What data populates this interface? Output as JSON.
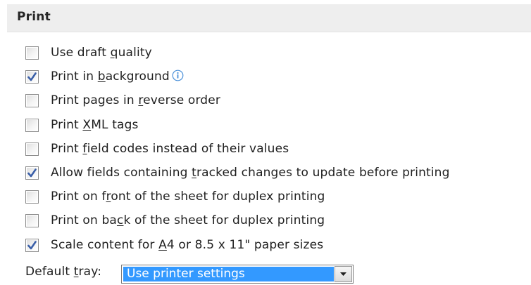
{
  "section": {
    "title": "Print"
  },
  "options": [
    {
      "id": "draft",
      "pre": "Use draft ",
      "u": "q",
      "post": "uality",
      "checked": false
    },
    {
      "id": "background",
      "pre": "Print in ",
      "u": "b",
      "post": "ackground",
      "checked": true,
      "info_icon": "info-icon"
    },
    {
      "id": "reverse",
      "pre": "Print pages in ",
      "u": "r",
      "post": "everse order",
      "checked": false
    },
    {
      "id": "xml",
      "pre": "Print ",
      "u": "X",
      "post": "ML tags",
      "checked": false
    },
    {
      "id": "field-codes",
      "pre": "Print ",
      "u": "f",
      "post": "ield codes instead of their values",
      "checked": false
    },
    {
      "id": "tracked-changes",
      "pre": "Allow fields containing ",
      "u": "t",
      "post": "racked changes to update before printing",
      "checked": true
    },
    {
      "id": "duplex-front",
      "pre": "Print on f",
      "u": "r",
      "post": "ont of the sheet for duplex printing",
      "checked": false
    },
    {
      "id": "duplex-back",
      "pre": "Print on ba",
      "u": "c",
      "post": "k of the sheet for duplex printing",
      "checked": false
    },
    {
      "id": "scale-content",
      "pre": "Scale content for ",
      "u": "A",
      "post": "4 or 8.5 x 11\" paper sizes",
      "checked": true
    }
  ],
  "tray": {
    "label_pre": "Default ",
    "label_u": "t",
    "label_post": "ray:",
    "value": "Use printer settings"
  },
  "colors": {
    "checkmark": "#3a5fa8",
    "selection": "#3399ff",
    "header_bg": "#eeeeee",
    "info_icon": "#4a90d9"
  }
}
